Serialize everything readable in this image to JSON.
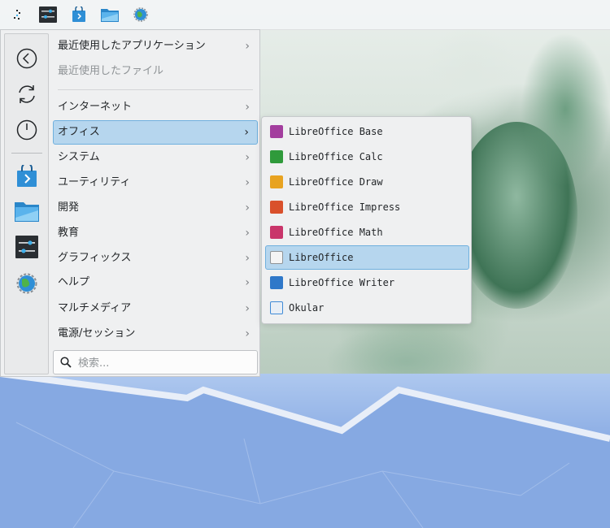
{
  "taskbar": {
    "items": [
      {
        "name": "application-launcher",
        "icon": "launcher-icon"
      },
      {
        "name": "system-settings",
        "icon": "settings-icon"
      },
      {
        "name": "discover-store",
        "icon": "store-bag-icon"
      },
      {
        "name": "file-manager",
        "icon": "folder-icon"
      },
      {
        "name": "web-browser",
        "icon": "globe-icon"
      }
    ]
  },
  "sidebar": {
    "actions": [
      {
        "name": "back",
        "icon": "back-arrow-icon"
      },
      {
        "name": "restart",
        "icon": "restart-icon"
      },
      {
        "name": "shutdown",
        "icon": "power-icon"
      }
    ],
    "favorites": [
      {
        "name": "store",
        "icon": "store-bag-icon"
      },
      {
        "name": "files",
        "icon": "folder-icon"
      },
      {
        "name": "settings",
        "icon": "settings-icon"
      },
      {
        "name": "browser",
        "icon": "globe-icon"
      }
    ]
  },
  "menu": {
    "recent_apps": "最近使用したアプリケーション",
    "recent_files": "最近使用したファイル",
    "categories": [
      "インターネット",
      "オフィス",
      "システム",
      "ユーティリティ",
      "開発",
      "教育",
      "グラフィックス",
      "ヘルプ",
      "マルチメディア",
      "電源/セッション"
    ],
    "active_category": "オフィス",
    "chevron": "›"
  },
  "search": {
    "placeholder": "検索..."
  },
  "office_apps": [
    {
      "label": "LibreOffice Base",
      "color": "#a33e9e"
    },
    {
      "label": "LibreOffice Calc",
      "color": "#2f9a3b"
    },
    {
      "label": "LibreOffice Draw",
      "color": "#e8a321"
    },
    {
      "label": "LibreOffice Impress",
      "color": "#d9502b"
    },
    {
      "label": "LibreOffice Math",
      "color": "#c9356a"
    },
    {
      "label": "LibreOffice",
      "color": "#8f9396"
    },
    {
      "label": "LibreOffice Writer",
      "color": "#2f78c9"
    },
    {
      "label": "Okular",
      "color": "#3f8ad6"
    }
  ],
  "active_app": "LibreOffice",
  "colors": {
    "accent": "#6fb0de",
    "highlight": "#b6d6ee"
  }
}
